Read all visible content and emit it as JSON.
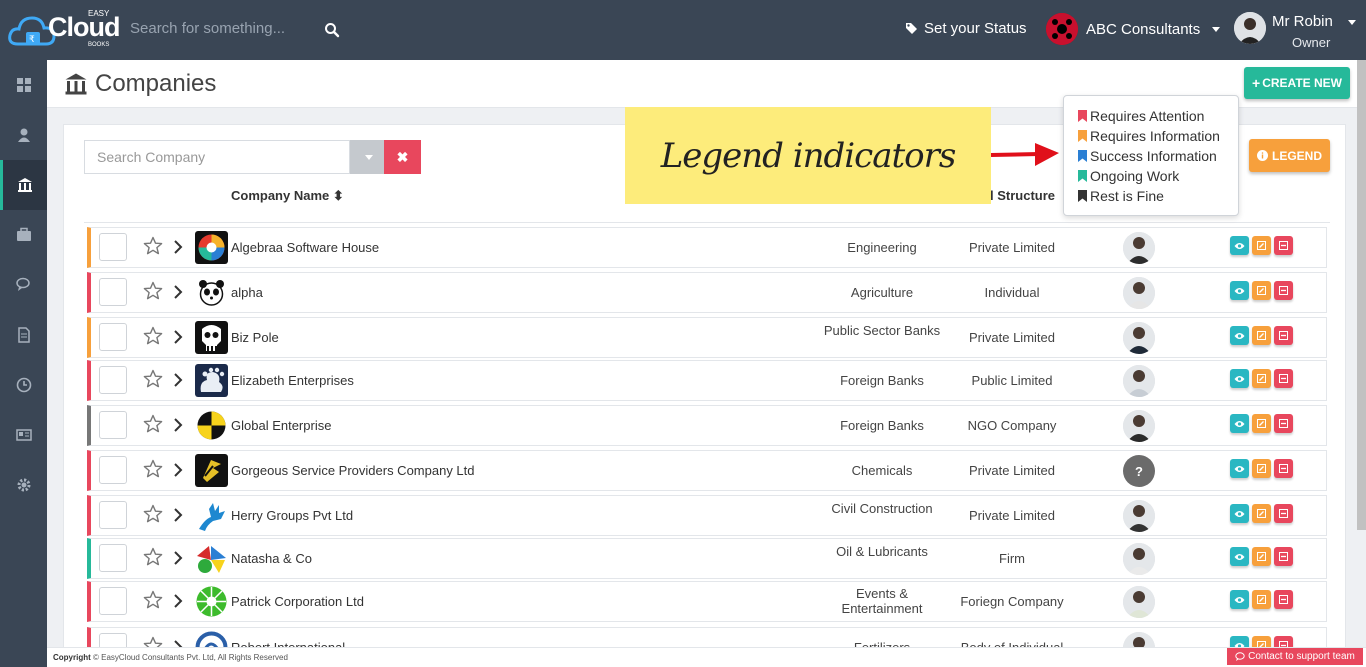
{
  "header": {
    "brand": "Cloud",
    "brand_top": "EASY",
    "brand_bottom": "BOOKS",
    "search_placeholder": "Search for something...",
    "status_label": "Set your Status",
    "company": "ABC Consultants",
    "user_name": "Mr Robin",
    "user_role": "Owner"
  },
  "sidebar": {
    "items": [
      {
        "icon": "dashboard-icon"
      },
      {
        "icon": "user-icon"
      },
      {
        "icon": "bank-icon",
        "active": true
      },
      {
        "icon": "briefcase-icon"
      },
      {
        "icon": "chat-icon"
      },
      {
        "icon": "document-icon"
      },
      {
        "icon": "clock-icon"
      },
      {
        "icon": "newspaper-icon"
      },
      {
        "icon": "gear-icon"
      }
    ]
  },
  "page": {
    "title": "Companies",
    "create_label": "CREATE NEW"
  },
  "toolbar": {
    "search_placeholder": "Search Company",
    "clear_label": "✖"
  },
  "columns": {
    "name": "Company Name",
    "structure": "l Structure"
  },
  "annotation": {
    "text": "Legend indicators"
  },
  "legend": {
    "button_label": "LEGEND",
    "items": [
      {
        "label": "Requires Attention",
        "color": "#e8475d"
      },
      {
        "label": "Requires Information",
        "color": "#f7a03c"
      },
      {
        "label": "Success Information",
        "color": "#2a7fd4"
      },
      {
        "label": "Ongoing Work",
        "color": "#26b99a"
      },
      {
        "label": "Rest is Fine",
        "color": "#333333"
      }
    ]
  },
  "companies": [
    {
      "name": "Algebraa Software House",
      "industry": "Engineering",
      "structure": "Private Limited",
      "status_color": "#f7a03c"
    },
    {
      "name": "alpha",
      "industry": "Agriculture",
      "structure": "Individual",
      "status_color": "#e8475d"
    },
    {
      "name": "Biz Pole",
      "industry": "Public Sector Banks",
      "structure": "Private Limited",
      "status_color": "#f7a03c"
    },
    {
      "name": "Elizabeth Enterprises",
      "industry": "Foreign Banks",
      "structure": "Public Limited",
      "status_color": "#e8475d"
    },
    {
      "name": "Global Enterprise",
      "industry": "Foreign Banks",
      "structure": "NGO Company",
      "status_color": "#777777"
    },
    {
      "name": "Gorgeous Service Providers Company Ltd",
      "industry": "Chemicals",
      "structure": "Private Limited",
      "status_color": "#e8475d",
      "person_unknown": "?"
    },
    {
      "name": "Herry Groups Pvt Ltd",
      "industry": "Civil Construction",
      "structure": "Private Limited",
      "status_color": "#e8475d"
    },
    {
      "name": "Natasha & Co",
      "industry": "Oil & Lubricants",
      "structure": "Firm",
      "status_color": "#26b99a"
    },
    {
      "name": "Patrick Corporation Ltd",
      "industry": "Events & Entertainment",
      "structure": "Foriegn Company",
      "status_color": "#e8475d"
    },
    {
      "name": "Robert International",
      "industry": "Fertilizers",
      "structure": "Body of Individual",
      "status_color": "#e8475d"
    }
  ],
  "footer": {
    "copyright_label": "Copyright",
    "copyright_text": "© EasyCloud Consultants Pvt. Ltd, All Rights Reserved",
    "support_label": "Contact to support team"
  }
}
